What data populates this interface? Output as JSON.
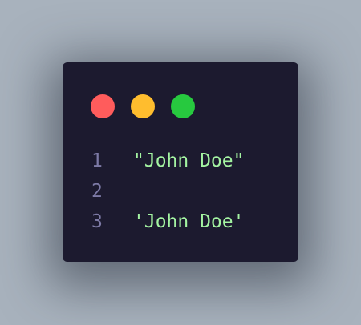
{
  "window": {
    "traffic_lights": [
      {
        "name": "close",
        "color": "#ff5c5c"
      },
      {
        "name": "minimize",
        "color": "#ffbd2e"
      },
      {
        "name": "maximize",
        "color": "#27c93f"
      }
    ]
  },
  "editor": {
    "lines": [
      {
        "number": "1",
        "text": "\"John Doe\""
      },
      {
        "number": "2",
        "text": ""
      },
      {
        "number": "3",
        "text": "'John Doe'"
      }
    ]
  }
}
